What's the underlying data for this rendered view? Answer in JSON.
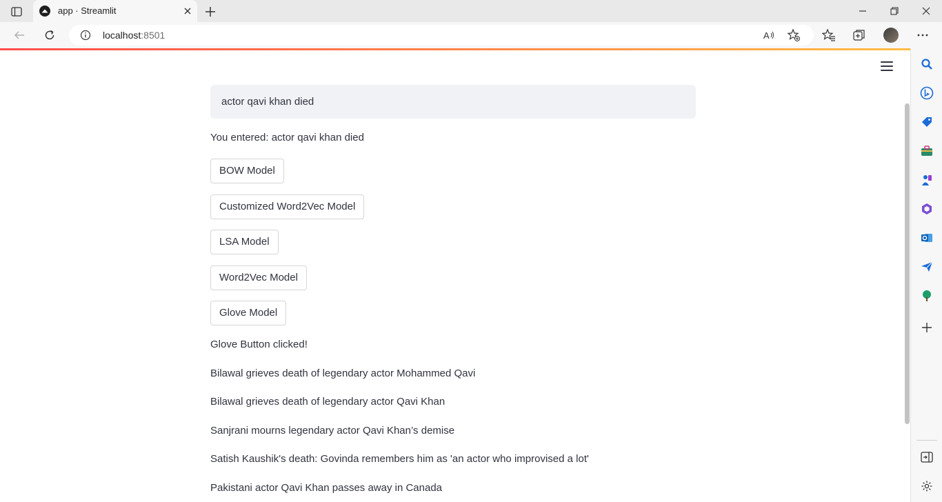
{
  "browser": {
    "tab_title": "app · Streamlit",
    "url_host": "localhost",
    "url_port": ":8501"
  },
  "icons": {
    "tab_actions": "tab-actions-icon",
    "favicon": "streamlit-favicon-icon",
    "tab_close": "close-icon",
    "new_tab": "plus-icon",
    "minimize": "minimize-icon",
    "restore": "restore-icon",
    "close_window": "close-icon",
    "back": "back-arrow-icon",
    "refresh": "refresh-icon",
    "site_info": "info-icon",
    "read_aloud": "read-aloud-icon",
    "add_favorite": "add-favorite-icon",
    "favorites": "favorites-icon",
    "collections": "collections-icon",
    "more": "more-icon",
    "menu": "hamburger-menu-icon"
  },
  "colors": {
    "streamlit_red": "#ff4b4b",
    "accent_yellow": "#ffbd45",
    "input_bg": "#f0f2f6",
    "text": "#31333f"
  },
  "app": {
    "input_value": "actor qavi khan died",
    "echo_text": "You entered: actor qavi khan died",
    "buttons": [
      "BOW Model",
      "Customized Word2Vec Model",
      "LSA Model",
      "Word2Vec Model",
      "Glove Model"
    ],
    "status": "Glove Button clicked!",
    "results": [
      "Bilawal grieves death of legendary actor Mohammed Qavi",
      "Bilawal grieves death of legendary actor Qavi Khan",
      "Sanjrani mourns legendary actor Qavi Khan’s demise",
      "Satish Kaushik's death: Govinda remembers him as 'an actor who improvised a lot'",
      "Pakistani actor Qavi Khan passes away in Canada"
    ]
  },
  "sidebar_icons": [
    "search-icon",
    "bing-chat-icon",
    "shopping-tag-icon",
    "tools-briefcase-icon",
    "games-icon",
    "microsoft365-icon",
    "outlook-icon",
    "drop-send-icon",
    "tree-icon",
    "add-icon",
    "split-screen-icon",
    "settings-icon"
  ]
}
